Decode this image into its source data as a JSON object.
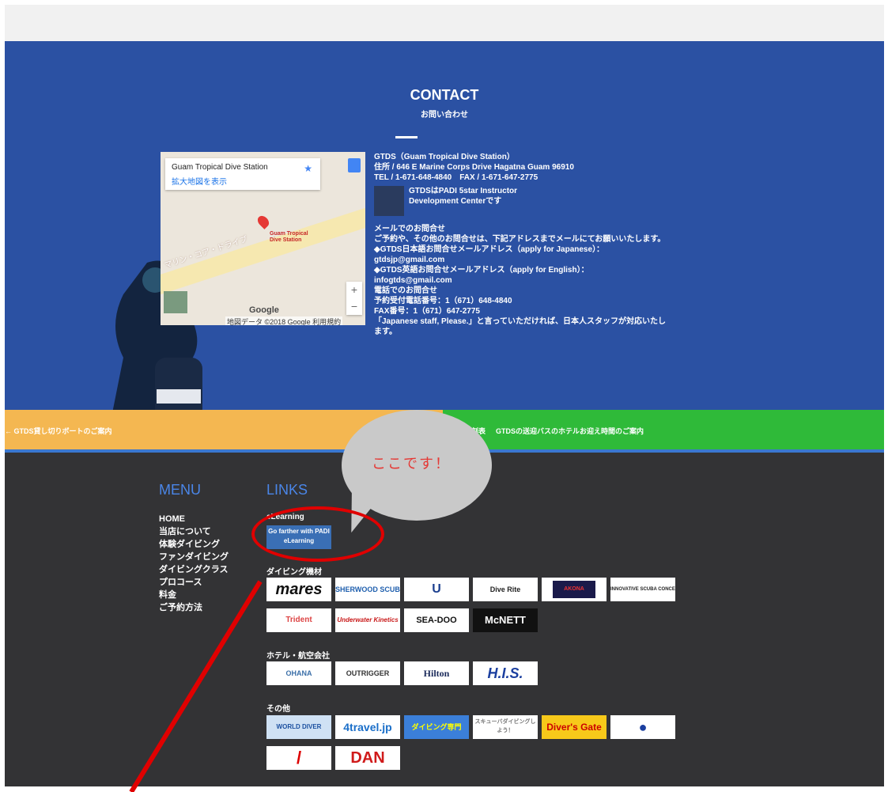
{
  "contact": {
    "title": "CONTACT",
    "subtitle": "お問い合わせ"
  },
  "map": {
    "place_name": "Guam Tropical Dive Station",
    "expand_link": "拡大地図を表示",
    "road_label": "マリン・コア・ドライブ",
    "pin_label": "Guam Tropical Dive Station",
    "zoom_in": "+",
    "zoom_out": "−",
    "google_label": "Google",
    "footer_text": "地図データ ©2018 Google 利用規約"
  },
  "info": {
    "company": "GTDS（Guam Tropical Dive Station）",
    "address": "住所 / 646 E Marine Corps Drive Hagatna Guam 96910",
    "tel_fax": "TEL / 1-671-648-4840　FAX / 1-671-647-2775",
    "padi_line1": "GTDSはPADI 5star Instructor",
    "padi_line2": "Development Centerです",
    "mail_heading": "メールでのお問合せ",
    "mail_desc": "ご予約や、その他のお問合せは、下記アドレスまでメールにてお願いいたします。",
    "jp_label": "◆GTDS日本語お問合せメールアドレス（apply for Japanese）：",
    "jp_email": "gtdsjp@gmail.com",
    "en_label": "◆GTDS英語お問合せメールアドレス（apply for English）：",
    "en_email": "infogtds@gmail.com",
    "phone_heading": "電話でのお問合せ",
    "reserve_phone": "予約受付電話番号：1（671）648-4840",
    "fax_number": "FAX番号：1（671）647-2775",
    "japanese_staff": "「Japanese staff, Please.」と言っていただければ、日本人スタッフが対応いたし",
    "japanese_staff_2": "ます。"
  },
  "strips": {
    "left": "← GTDS貸し切りボートのご案内",
    "right_prefix": "刻表",
    "right": "GTDSの送迎バスのホテルお迎え時間のご案内"
  },
  "callout": {
    "text": "ここです！"
  },
  "footer": {
    "menu_heading": "MENU",
    "links_heading": "LINKS",
    "menu_items": [
      "HOME",
      "当店について",
      "体験ダイビング",
      "ファンダイビング",
      "ダイビングクラス",
      "プロコース",
      "料金",
      "ご予約方法"
    ],
    "cat_elearning": "eLearning",
    "cat_equipment": "ダイビング機材",
    "cat_hotel": "ホテル・航空会社",
    "cat_other": "その他",
    "logos": {
      "padi": "Go farther with PADI eLearning",
      "mares": "mares",
      "sherwood": "SHERWOOD SCUBA",
      "aqualung": "U",
      "diverite": "Dive Rite",
      "akona": "AKONA",
      "isc": "INNOVATIVE SCUBA CONCEPTS",
      "trident": "Trident",
      "uk": "Underwater Kinetics",
      "seadoo": "SEA-DOO",
      "mcnett": "McNETT",
      "ohana": "OHANA",
      "outrigger": "OUTRIGGER",
      "hilton": "Hilton",
      "his": "H.I.S.",
      "worlddiver": "WORLD DIVER",
      "travel": "4travel.jp",
      "diving_shop": "ダイビング専門",
      "scuba_lets": "スキューバダイビングしよう！",
      "divers_gate": "Diver's Gate",
      "dive_flag": "●",
      "flag_icon": "/",
      "dan": "DAN"
    }
  },
  "colors": {
    "hero_blue": "#2b51a3",
    "strip_orange": "#f4b751",
    "strip_green": "#2fba39",
    "footer_dark": "#333335",
    "heading_blue": "#4a86e8",
    "annotation_red": "#e00000"
  }
}
